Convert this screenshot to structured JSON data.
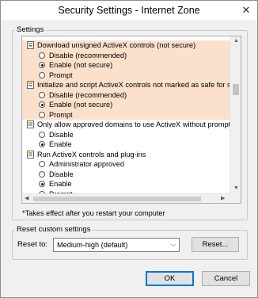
{
  "window": {
    "title": "Security Settings - Internet Zone",
    "close_label": "✕"
  },
  "settings": {
    "group_label": "Settings",
    "rows": [
      {
        "kind": "header",
        "label": "Download unsigned ActiveX controls (not secure)",
        "highlight": true
      },
      {
        "kind": "radio",
        "label": "Disable (recommended)",
        "selected": false,
        "highlight": true
      },
      {
        "kind": "radio",
        "label": "Enable (not secure)",
        "selected": true,
        "highlight": true
      },
      {
        "kind": "radio",
        "label": "Prompt",
        "selected": false,
        "highlight": true
      },
      {
        "kind": "header",
        "label": "Initialize and script ActiveX controls not marked as safe for sc",
        "highlight": true
      },
      {
        "kind": "radio",
        "label": "Disable (recommended)",
        "selected": false,
        "highlight": true
      },
      {
        "kind": "radio",
        "label": "Enable (not secure)",
        "selected": true,
        "highlight": true
      },
      {
        "kind": "radio",
        "label": "Prompt",
        "selected": false,
        "highlight": true
      },
      {
        "kind": "header",
        "label": "Only allow approved domains to use ActiveX without prompt",
        "highlight": false
      },
      {
        "kind": "radio",
        "label": "Disable",
        "selected": false,
        "highlight": false
      },
      {
        "kind": "radio",
        "label": "Enable",
        "selected": true,
        "highlight": false
      },
      {
        "kind": "header",
        "label": "Run ActiveX controls and plug-ins",
        "highlight": false
      },
      {
        "kind": "radio",
        "label": "Administrator approved",
        "selected": false,
        "highlight": false
      },
      {
        "kind": "radio",
        "label": "Disable",
        "selected": false,
        "highlight": false
      },
      {
        "kind": "radio",
        "label": "Enable",
        "selected": true,
        "highlight": false
      },
      {
        "kind": "radio",
        "label": "Prompt",
        "selected": false,
        "highlight": false
      }
    ],
    "highlight_color": "#fbe0cb"
  },
  "note": "*Takes effect after you restart your computer",
  "reset": {
    "group_label": "Reset custom settings",
    "reset_to_label": "Reset to:",
    "selected_level": "Medium-high (default)",
    "reset_button": "Reset..."
  },
  "buttons": {
    "ok": "OK",
    "cancel": "Cancel"
  },
  "colors": {
    "accent": "#0078d7"
  }
}
